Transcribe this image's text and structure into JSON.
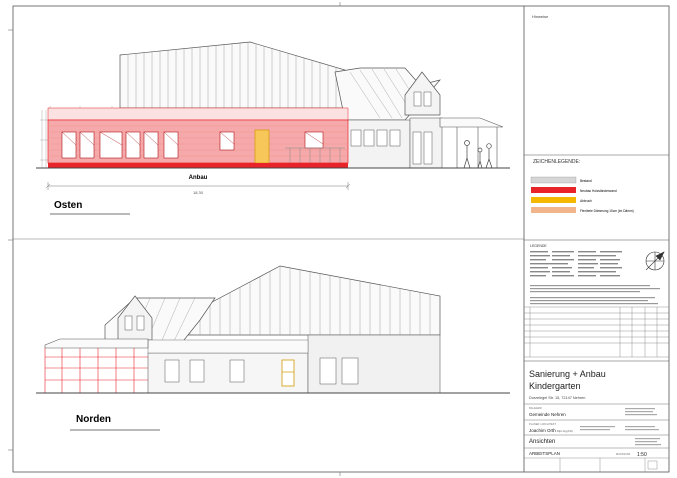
{
  "colors": {
    "bestand": "#d6d6d6",
    "neubau": "#e8232a",
    "abbruch": "#f5b800",
    "daemmung": "#f2b48a",
    "neubau_fill": "#f6a9aa",
    "roof_line": "#555555"
  },
  "views": {
    "east": {
      "title": "Osten",
      "section_label": "Anbau",
      "dimension": "18.30"
    },
    "north": {
      "title": "Norden"
    }
  },
  "panel": {
    "hinweise_label": "Hinweise",
    "legend_title": "ZEICHENLEGENDE:",
    "legend": [
      {
        "label": "Bestand",
        "color_key": "bestand"
      },
      {
        "label": "Neubau Holzständerwand",
        "color_key": "neubau"
      },
      {
        "label": "Abbruch",
        "color_key": "abbruch"
      },
      {
        "label": "Flexibele Dämmung 10cm (im Dämm)",
        "color_key": "daemmung"
      }
    ],
    "legende_title": "LEGENDE",
    "project_title_1": "Sanierung + Anbau",
    "project_title_2": "Kindergarten",
    "address": "Dorzelegel Str. 15, 72147 Nehren",
    "client_label": "BAUHERR",
    "client": "Gemeinde Nehren",
    "architect_label": "PLANER / ARCHITEKT",
    "architect": "Joachim Orth",
    "architect_suffix": "Dipl.-Ing.(FH)",
    "sheet_title": "Ansichten",
    "plan_type": "ARBEITSPLAN",
    "scale_label": "MASSSTAB",
    "scale": "1:50"
  }
}
